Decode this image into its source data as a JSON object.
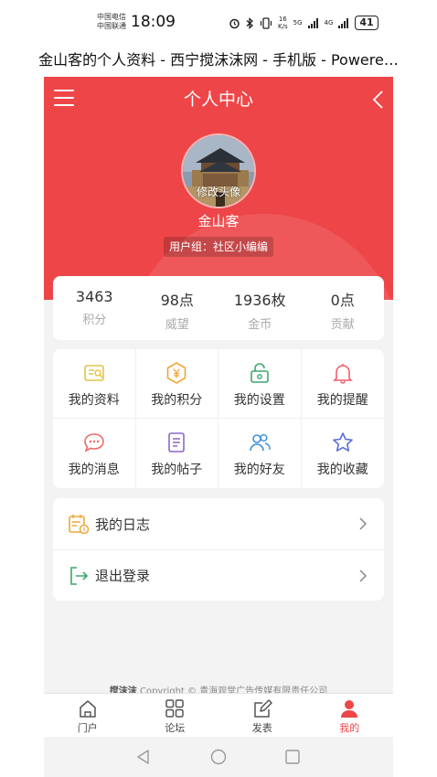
{
  "status_bar": {
    "carrier_1": "中国电信",
    "carrier_2": "中国联通",
    "time": "18:09",
    "net_speed_value": "16",
    "net_speed_unit": "K/s",
    "signal_1": "5G",
    "signal_2": "4G",
    "battery": "41"
  },
  "page_title": "金山客的个人资料 - 西宁搅沫沫网 - 手机版 - Powere…",
  "header": {
    "title": "个人中心",
    "avatar_label": "修改头像",
    "username": "金山客",
    "usergroup": "用户组：社区小编编"
  },
  "stats": [
    {
      "value": "3463",
      "label": "积分"
    },
    {
      "value": "98点",
      "label": "威望"
    },
    {
      "value": "1936枚",
      "label": "金币"
    },
    {
      "value": "0点",
      "label": "贡献"
    }
  ],
  "grid": [
    {
      "label": "我的资料",
      "icon": "profile-icon",
      "color": "#e2c44a"
    },
    {
      "label": "我的积分",
      "icon": "points-icon",
      "color": "#f0a63a"
    },
    {
      "label": "我的设置",
      "icon": "settings-icon",
      "color": "#3aa86b"
    },
    {
      "label": "我的提醒",
      "icon": "bell-icon",
      "color": "#ef5f6f"
    },
    {
      "label": "我的消息",
      "icon": "message-icon",
      "color": "#ee6a6a"
    },
    {
      "label": "我的帖子",
      "icon": "post-icon",
      "color": "#8a67c9"
    },
    {
      "label": "我的好友",
      "icon": "friends-icon",
      "color": "#3d8fd6"
    },
    {
      "label": "我的收藏",
      "icon": "star-icon",
      "color": "#5b6fd6"
    }
  ],
  "list": [
    {
      "label": "我的日志",
      "icon": "diary-icon",
      "color": "#f0a63a"
    },
    {
      "label": "退出登录",
      "icon": "logout-icon",
      "color": "#3aa86b"
    }
  ],
  "copyright": {
    "brand": "搅沫沫",
    "text": " Copyright © 青海观堂广告传媒有限责任公司"
  },
  "tabbar": [
    {
      "label": "门户",
      "icon": "home-icon",
      "active": false
    },
    {
      "label": "论坛",
      "icon": "forum-icon",
      "active": false
    },
    {
      "label": "发表",
      "icon": "compose-icon",
      "active": false
    },
    {
      "label": "我的",
      "icon": "user-icon",
      "active": true
    }
  ],
  "colors": {
    "brand_red": "#ee4648",
    "background": "#f3f3f3"
  }
}
